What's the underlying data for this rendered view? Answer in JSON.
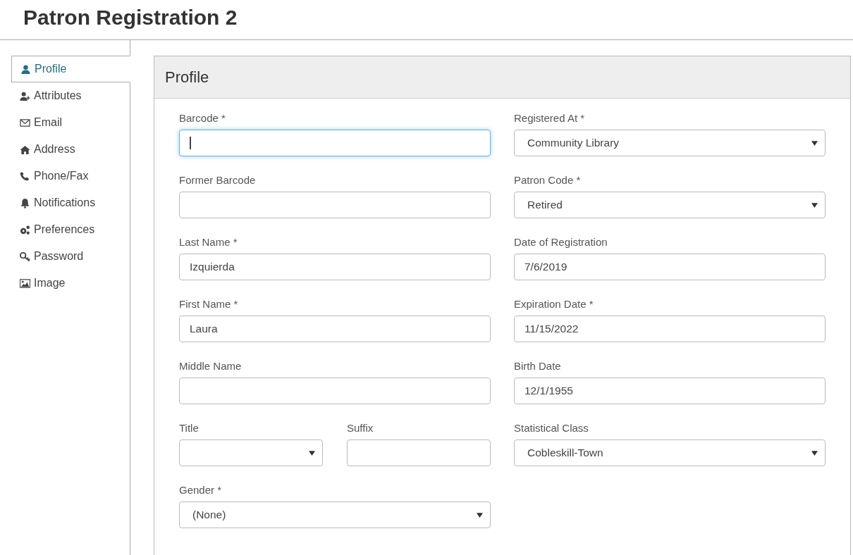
{
  "page_title": "Patron Registration 2",
  "sidebar": {
    "items": [
      {
        "label": "Profile",
        "selected": true
      },
      {
        "label": "Attributes",
        "selected": false
      },
      {
        "label": "Email",
        "selected": false
      },
      {
        "label": "Address",
        "selected": false
      },
      {
        "label": "Phone/Fax",
        "selected": false
      },
      {
        "label": "Notifications",
        "selected": false
      },
      {
        "label": "Preferences",
        "selected": false
      },
      {
        "label": "Password",
        "selected": false
      },
      {
        "label": "Image",
        "selected": false
      }
    ]
  },
  "panel": {
    "title": "Profile",
    "left_column": [
      {
        "kind": "text",
        "label": "Barcode *",
        "focused": true
      },
      {
        "kind": "text",
        "label": "Former Barcode",
        "focused": false
      },
      {
        "kind": "text",
        "label": "Last Name *",
        "value": "Izquierda",
        "focused": false
      },
      {
        "kind": "text",
        "label": "First Name *",
        "value": "Laura",
        "focused": false
      },
      {
        "kind": "text",
        "label": "Middle Name",
        "focused": false
      },
      {
        "kind": "pair",
        "fields": [
          {
            "kind": "select",
            "label": "Title"
          },
          {
            "kind": "text",
            "label": "Suffix",
            "focused": false
          }
        ]
      },
      {
        "kind": "select",
        "label": "Gender *",
        "value": "(None)"
      }
    ],
    "right_column": [
      {
        "kind": "select",
        "label": "Registered At *",
        "value": "Community Library"
      },
      {
        "kind": "select",
        "label": "Patron Code *",
        "value": "Retired"
      },
      {
        "kind": "text",
        "label": "Date of Registration",
        "value": "7/6/2019",
        "focused": false
      },
      {
        "kind": "text",
        "label": "Expiration Date *",
        "value": "11/15/2022",
        "focused": false
      },
      {
        "kind": "text",
        "label": "Birth Date",
        "value": "12/1/1955",
        "focused": false
      },
      {
        "kind": "select",
        "label": "Statistical Class",
        "value": "Cobleskill-Town"
      }
    ]
  }
}
